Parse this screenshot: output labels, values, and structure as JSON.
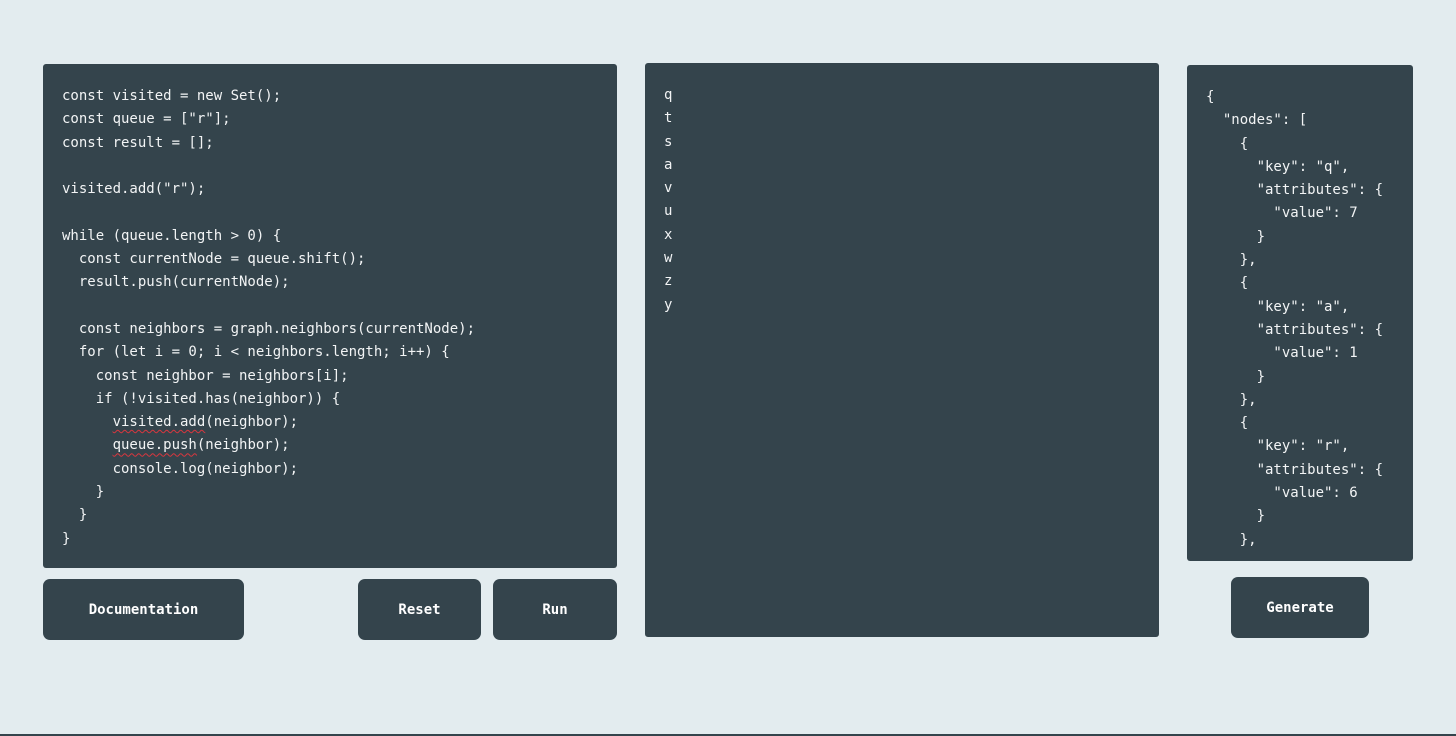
{
  "editor": {
    "lines": [
      "const visited = new Set();",
      "const queue = [\"r\"];",
      "const result = [];",
      "",
      "visited.add(\"r\");",
      "",
      "while (queue.length > 0) {",
      "  const currentNode = queue.shift();",
      "  result.push(currentNode);",
      "",
      "  const neighbors = graph.neighbors(currentNode);",
      "  for (let i = 0; i < neighbors.length; i++) {",
      "    const neighbor = neighbors[i];",
      "    if (!visited.has(neighbor)) {",
      "      ",
      "      ",
      "      console.log(neighbor);",
      "    }",
      "  }",
      "}"
    ],
    "squiggle_line_1": {
      "indent": "      ",
      "word": "visited.add",
      "rest": "(neighbor);"
    },
    "squiggle_line_2": {
      "indent": "      ",
      "word": "queue.push",
      "rest": "(neighbor);"
    }
  },
  "output": {
    "lines": [
      "q",
      "t",
      "s",
      "a",
      "v",
      "u",
      "x",
      "w",
      "z",
      "y"
    ]
  },
  "json_view": {
    "lines": [
      "{",
      "  \"nodes\": [",
      "    {",
      "      \"key\": \"q\",",
      "      \"attributes\": {",
      "        \"value\": 7",
      "      }",
      "    },",
      "    {",
      "      \"key\": \"a\",",
      "      \"attributes\": {",
      "        \"value\": 1",
      "      }",
      "    },",
      "    {",
      "      \"key\": \"r\",",
      "      \"attributes\": {",
      "        \"value\": 6",
      "      }",
      "    },"
    ]
  },
  "buttons": {
    "documentation": "Documentation",
    "reset": "Reset",
    "run": "Run",
    "generate": "Generate"
  },
  "colors": {
    "background": "#e3ecef",
    "panel": "#34444c",
    "text": "#f2f4f5",
    "spellcheck": "#d9363e"
  }
}
